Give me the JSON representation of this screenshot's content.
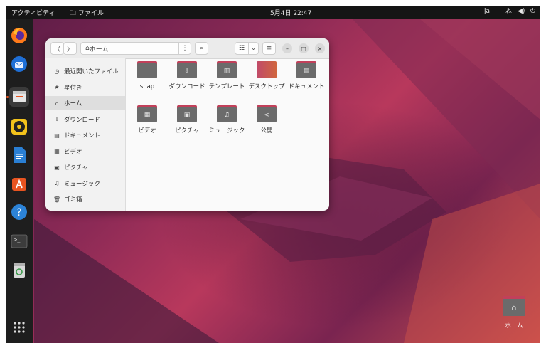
{
  "topbar": {
    "activities": "アクティビティ",
    "app_menu": "ファイル",
    "clock": "5月4日 22:47",
    "lang": "ja"
  },
  "dock": {
    "items": [
      "firefox-icon",
      "thunderbird-icon",
      "files-icon",
      "rhythmbox-icon",
      "writer-icon",
      "software-icon",
      "help-icon",
      "terminal-icon",
      "trash-icon"
    ],
    "show_apps": "show-apps-icon"
  },
  "window": {
    "path_label": "ホーム",
    "sidebar": [
      {
        "icon": "◷",
        "label": "最近開いたファイル"
      },
      {
        "icon": "★",
        "label": "星付き"
      },
      {
        "icon": "⌂",
        "label": "ホーム"
      },
      {
        "icon": "⇩",
        "label": "ダウンロード"
      },
      {
        "icon": "▤",
        "label": "ドキュメント"
      },
      {
        "icon": "▦",
        "label": "ビデオ"
      },
      {
        "icon": "▣",
        "label": "ピクチャ"
      },
      {
        "icon": "♫",
        "label": "ミュージック"
      },
      {
        "icon": "🗑",
        "label": "ゴミ箱"
      }
    ],
    "files": [
      {
        "label": "snap",
        "glyph": ""
      },
      {
        "label": "ダウンロード",
        "glyph": "⇩"
      },
      {
        "label": "テンプレート",
        "glyph": "▥"
      },
      {
        "label": "デスクトップ",
        "glyph": ""
      },
      {
        "label": "ドキュメント",
        "glyph": "▤"
      },
      {
        "label": "ビデオ",
        "glyph": "▦"
      },
      {
        "label": "ピクチャ",
        "glyph": "▣"
      },
      {
        "label": "ミュージック",
        "glyph": "♫"
      },
      {
        "label": "公開",
        "glyph": "<"
      }
    ]
  },
  "desktop": {
    "home_label": "ホーム"
  }
}
